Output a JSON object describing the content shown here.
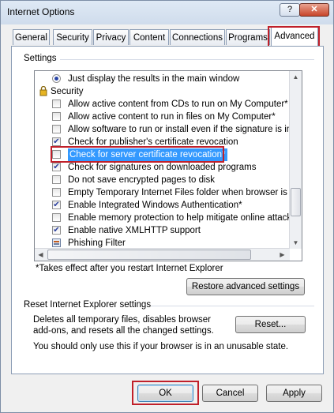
{
  "window": {
    "title": "Internet Options",
    "help_label": "?",
    "close_label": "✕"
  },
  "tabs": [
    "General",
    "Security",
    "Privacy",
    "Content",
    "Connections",
    "Programs",
    "Advanced"
  ],
  "settings": {
    "group_label": "Settings",
    "items": [
      {
        "type": "radio",
        "label": "Just display the results in the main window"
      },
      {
        "type": "category",
        "label": "Security"
      },
      {
        "type": "checkbox",
        "checked": false,
        "label": "Allow active content from CDs to run on My Computer*"
      },
      {
        "type": "checkbox",
        "checked": false,
        "label": "Allow active content to run in files on My Computer*"
      },
      {
        "type": "checkbox",
        "checked": false,
        "label": "Allow software to run or install even if the signature is inva"
      },
      {
        "type": "checkbox",
        "checked": true,
        "label": "Check for publisher's certificate revocation"
      },
      {
        "type": "checkbox",
        "checked": false,
        "label": "Check for server certificate revocation*"
      },
      {
        "type": "checkbox",
        "checked": true,
        "label": "Check for signatures on downloaded programs"
      },
      {
        "type": "checkbox",
        "checked": false,
        "label": "Do not save encrypted pages to disk"
      },
      {
        "type": "checkbox",
        "checked": false,
        "label": "Empty Temporary Internet Files folder when browser is clo"
      },
      {
        "type": "checkbox",
        "checked": true,
        "label": "Enable Integrated Windows Authentication*"
      },
      {
        "type": "checkbox",
        "checked": false,
        "label": "Enable memory protection to help mitigate online attacks"
      },
      {
        "type": "checkbox",
        "checked": true,
        "label": "Enable native XMLHTTP support"
      },
      {
        "type": "category",
        "label": "Phishing Filter"
      }
    ],
    "restart_note": "*Takes effect after you restart Internet Explorer",
    "restore_button": "Restore advanced settings"
  },
  "reset": {
    "group_label": "Reset Internet Explorer settings",
    "description_line1": "Deletes all temporary files, disables browser",
    "description_line2": "add-ons, and resets all the changed settings.",
    "warning": "You should only use this if your browser is in an unusable state.",
    "button": "Reset..."
  },
  "footer": {
    "ok": "OK",
    "cancel": "Cancel",
    "apply": "Apply"
  },
  "colors": {
    "highlight": "#c0202a",
    "selection": "#3399ff"
  }
}
